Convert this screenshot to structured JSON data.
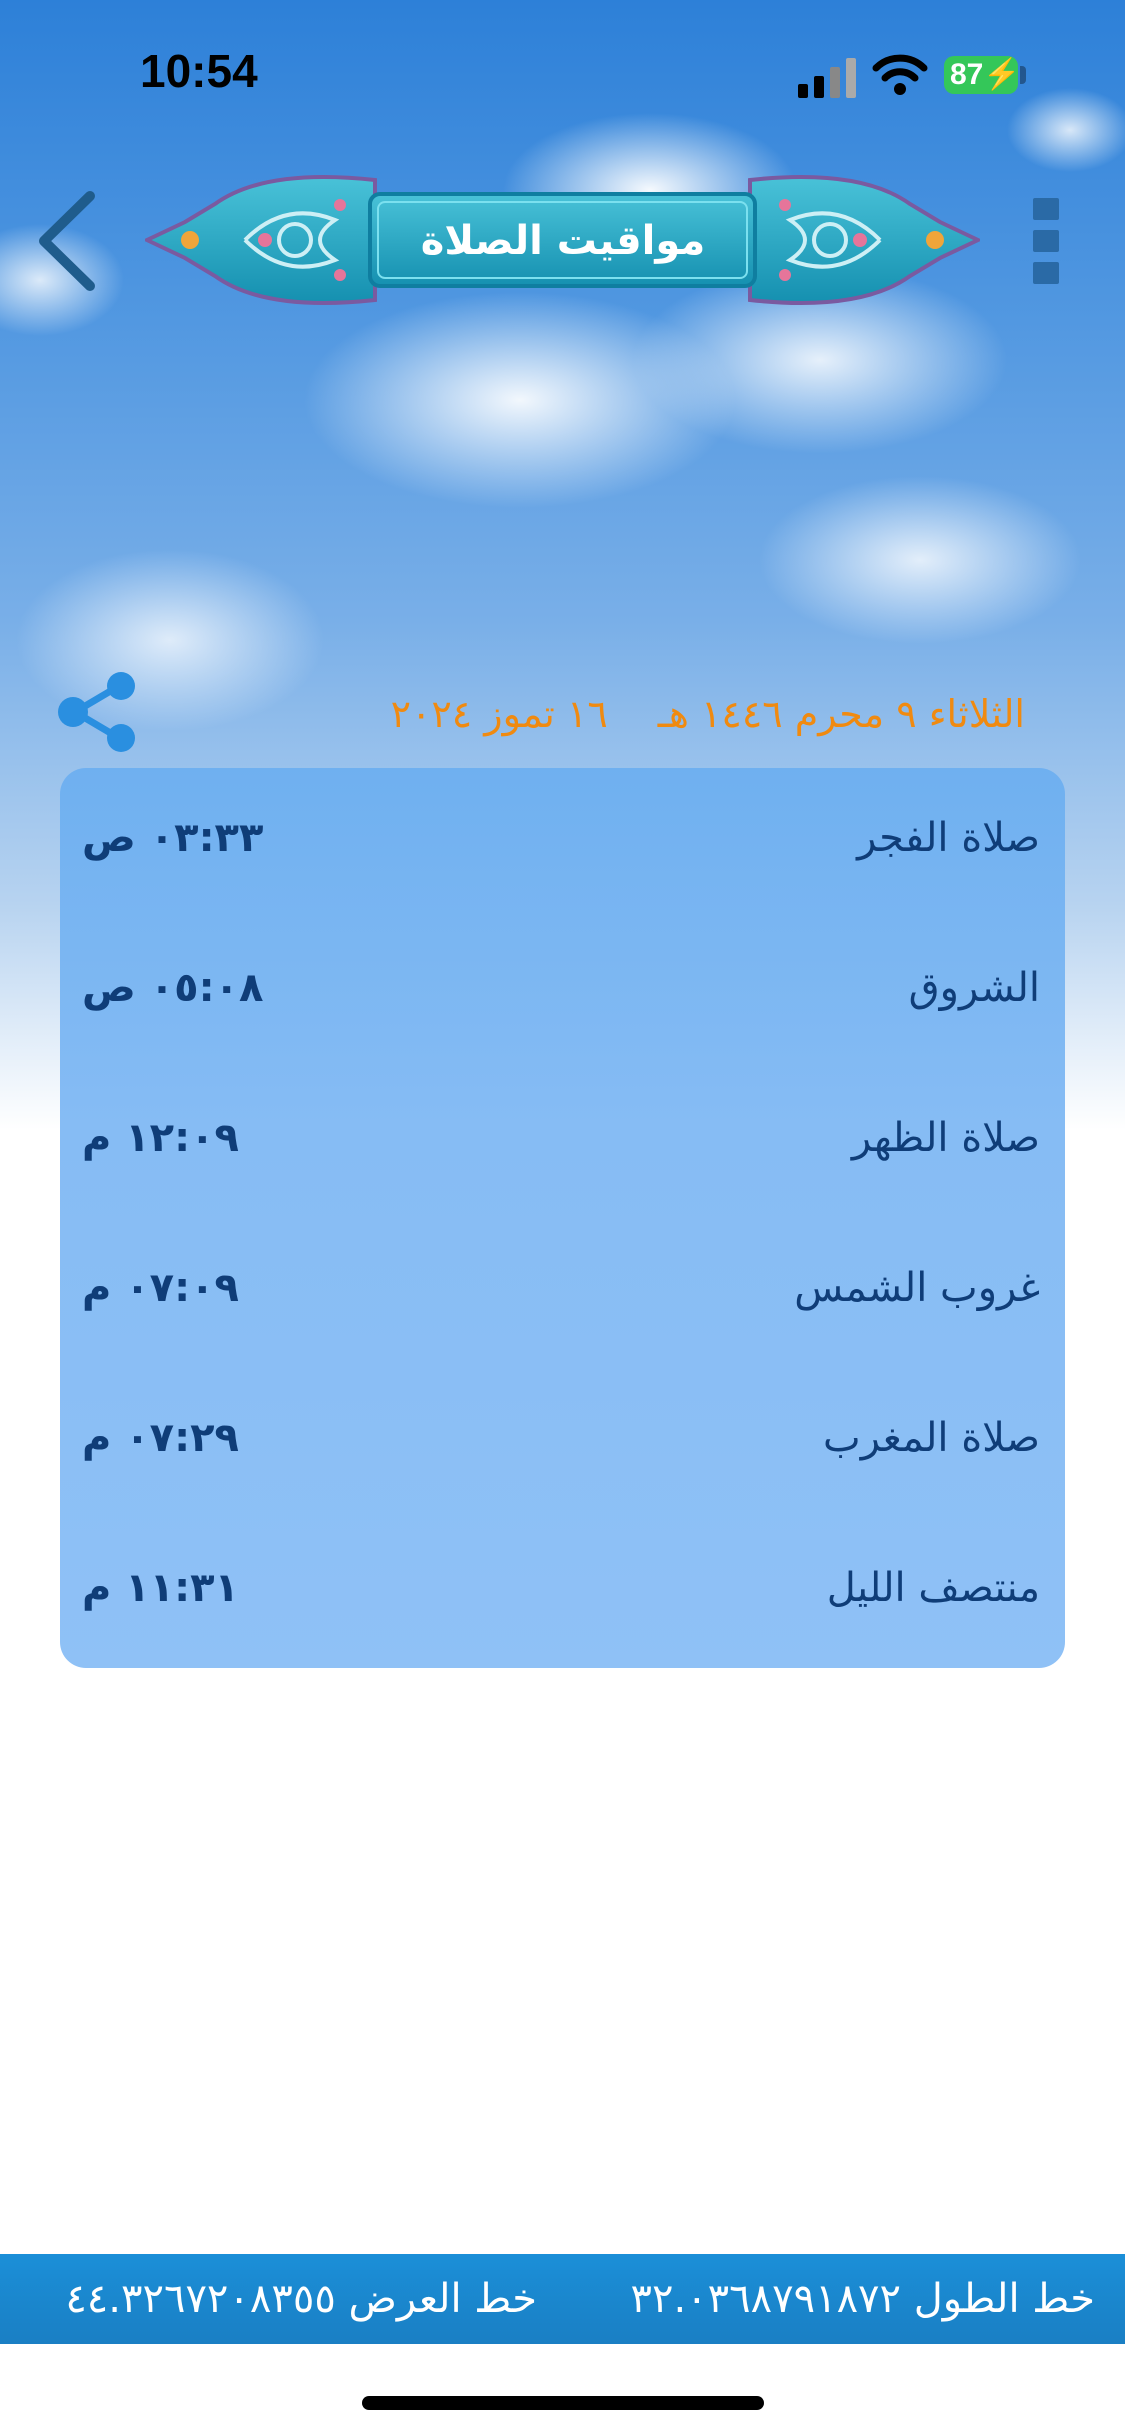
{
  "status_bar": {
    "time": "10:54",
    "battery": "87",
    "icons": [
      "signal-icon",
      "wifi-icon",
      "battery-charging-icon"
    ]
  },
  "header": {
    "title": "مواقيت الصلاة",
    "back_icon": "chevron-left-icon",
    "menu_icon": "menu-icon"
  },
  "date": {
    "hijri": "الثلاثاء ٩ محرم ١٤٤٦ هـ",
    "gregorian": "١٦ تموز ٢٠٢٤",
    "share_icon": "share-icon"
  },
  "prayer_times": [
    {
      "name": "صلاة الفجر",
      "time": "٠٣:٣٣ ص"
    },
    {
      "name": "الشروق",
      "time": "٠٥:٠٨ ص"
    },
    {
      "name": "صلاة الظهر",
      "time": "١٢:٠٩ م"
    },
    {
      "name": "غروب الشمس",
      "time": "٠٧:٠٩ م"
    },
    {
      "name": "صلاة المغرب",
      "time": "٠٧:٢٩ م"
    },
    {
      "name": "منتصف الليل",
      "time": "١١:٣١ م"
    }
  ],
  "location": {
    "longitude": "خط الطول ٣٢.٠٣٦٨٧٩١٨٧٢",
    "latitude": "خط العرض ٤٤.٣٢٦٧٢٠٨٣٥٥"
  },
  "colors": {
    "accent_orange": "#f08a10",
    "text_dark_blue": "#0f3d78",
    "panel_blue": "#86bcf4",
    "footer_blue": "#1a7fc4",
    "banner_teal": "#1fa3c2"
  }
}
